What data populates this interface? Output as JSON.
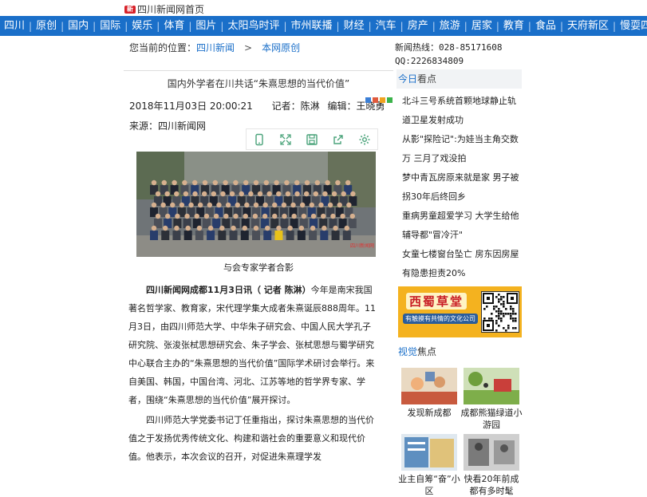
{
  "logo": {
    "badge": "新",
    "text": "四川新闻网首页"
  },
  "nav": [
    "四川",
    "原创",
    "国内",
    "国际",
    "娱乐",
    "体育",
    "图片",
    "太阳鸟时评",
    "市州联播",
    "财经",
    "汽车",
    "房产",
    "旅游",
    "居家",
    "教育",
    "食品",
    "天府新区",
    "慢耍四川"
  ],
  "breadcrumb": {
    "prefix": "您当前的位置：",
    "home": "四川新闻",
    "separator": ">",
    "current": "本网原创"
  },
  "hotline": {
    "phone": "新闻热线：028-85171608",
    "qq": "QQ:2226834809"
  },
  "article": {
    "title": "国内外学者在川共话“朱熹思想的当代价值”",
    "date": "2018年11月03日 20:00:21",
    "reporter": "记者：陈淋",
    "editor": "编辑：王晓勇",
    "source": "来源：四川新闻网",
    "photo_watermark": "四川新闻网",
    "photo_caption": "与会专家学者合影",
    "lead_bold": "四川新闻网成都11月3日讯（ 记者  陈淋）",
    "para1": "今年是南宋我国著名哲学家、教育家，宋代理学集大成者朱熹诞辰888周年。11月3日，由四川师范大学、中华朱子研究会、中国人民大学孔子研究院、张浚张栻思想研究会、朱子学会、张栻思想与蜀学研究中心联合主办的“朱熹思想的当代价值”国际学术研讨会举行。来自美国、韩国，中国台湾、河北、江苏等地的哲学界专家、学者，围绕“朱熹思想的当代价值”展开探讨。",
    "para2": "四川师范大学党委书记丁任重指出，探讨朱熹思想的当代价值之于发扬优秀传统文化、构建和谐社会的重要意义和现代价值。他表示，本次会议的召开，对促进朱熹理学发"
  },
  "toolbar": [
    "mobile-icon",
    "fullscreen-icon",
    "save-icon",
    "share-icon",
    "settings-icon"
  ],
  "right": {
    "today_title_accent": "今日",
    "today_title_rest": "看点",
    "news": [
      "北斗三号系统首颗地球静止轨道卫星发射成功",
      "从影\"探险记\":为娃当主角交数万 三月了戏没拍",
      "梦中青瓦房原来就是家 男子被拐30年后终回乡",
      "重病男童超爱学习 大学生给他辅导都\"冒冷汗\"",
      "女童七楼窗台坠亡 房东因房屋有隐患担责20%"
    ],
    "ad": {
      "title": "西蜀草堂",
      "sub": "有触摸有共情的文化公司"
    },
    "video_title_accent": "视觉",
    "video_title_rest": "焦点",
    "videos": [
      "发现新成都",
      "成都熊猫绿道小游园",
      "业主自筹“奋”小区",
      "快看20年前成都有多时髦"
    ]
  },
  "colors": {
    "nav_bg": "#1a6fc9",
    "accent": "#1a6fc9",
    "ad_bg": "#f4b21f",
    "ad_red": "#c81d25"
  }
}
